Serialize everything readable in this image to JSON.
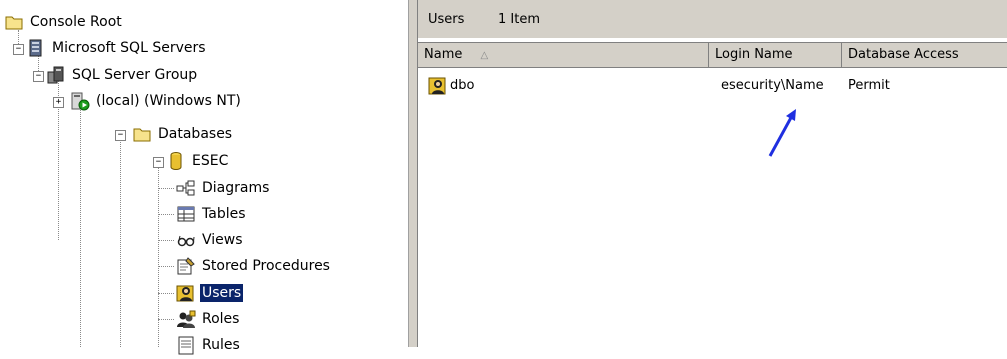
{
  "tree": {
    "console_root": "Console Root",
    "sql_servers": "Microsoft SQL Servers",
    "server_group": "SQL Server Group",
    "local_server": "(local) (Windows NT)",
    "databases": "Databases",
    "esec": "ESEC",
    "items": [
      "Diagrams",
      "Tables",
      "Views",
      "Stored Procedures",
      "Users",
      "Roles",
      "Rules"
    ],
    "selected": "Users"
  },
  "list_pane": {
    "header_title": "Users",
    "header_count": "1 Item",
    "columns": [
      "Name",
      "Login Name",
      "Database Access"
    ],
    "sort_indicator": "△",
    "rows": [
      {
        "name": "dbo",
        "login_name": "esecurity\\Name",
        "database_access": "Permit"
      }
    ]
  },
  "colors": {
    "selection": "#0a246a",
    "arrow": "#1f2fe0",
    "chrome": "#d4d0c8"
  }
}
